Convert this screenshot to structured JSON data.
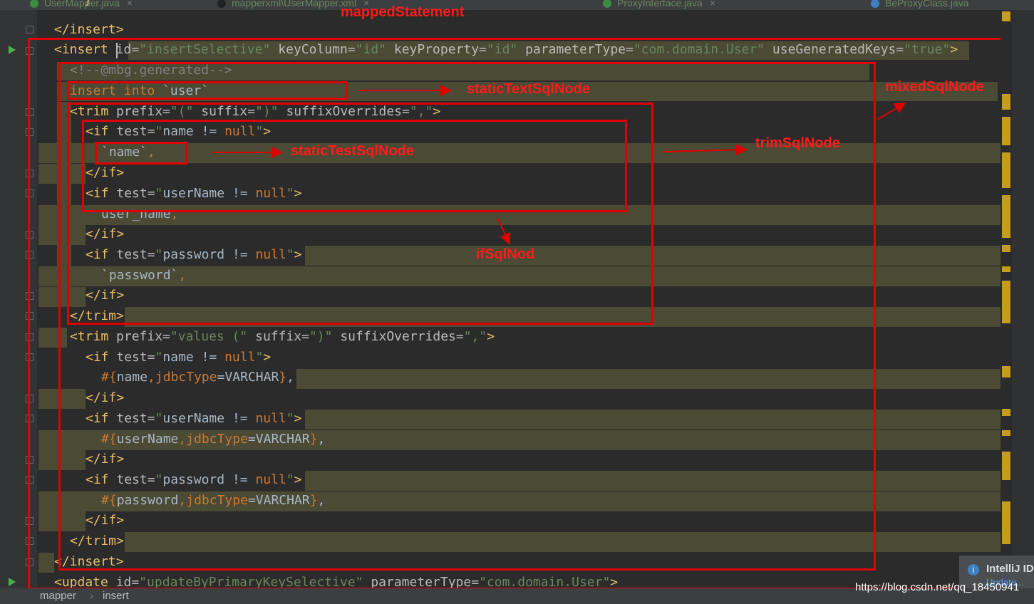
{
  "tabs": [
    {
      "label": "UserMapper.java",
      "close": "×"
    },
    {
      "label": "mapperxml\\UserMapper.xml",
      "close": "×"
    },
    {
      "label": "ProxyInterface.java",
      "close": "×"
    },
    {
      "label": "BeProxyClass.java",
      "close": "×"
    }
  ],
  "code": {
    "l0": "}",
    "l1_close_insert": "</insert>",
    "l2": {
      "open": "<insert ",
      "a1": "id=",
      "v1": "\"insertSelective\"",
      "a2": " keyColumn=",
      "v2": "\"id\"",
      "a3": " keyProperty=",
      "v3": "\"id\"",
      "a4": " parameterType=",
      "v4": "\"com.domain.User\"",
      "a5": " useGeneratedKeys=",
      "v5": "\"true\"",
      "close": ">"
    },
    "l3": "<!--@mbg.generated-->",
    "l4": {
      "kw": "insert into ",
      "txt": "`user`"
    },
    "l5": {
      "open": "<trim ",
      "a1": "prefix=",
      "v1": "\"(\"",
      "a2": " suffix=",
      "v2": "\")\"",
      "a3": " suffixOverrides=",
      "v3": "\",\"",
      "close": ">"
    },
    "l6": {
      "open": "<if ",
      "a1": "test=",
      "q1": "\"",
      "expr": "name != ",
      "nul": "null",
      "q2": "\"",
      "close": ">"
    },
    "l7": {
      "txt": "`name`",
      "comma": ","
    },
    "l8": "</if>",
    "l9": {
      "open": "<if ",
      "a1": "test=",
      "q1": "\"",
      "expr": "userName != ",
      "nul": "null",
      "q2": "\"",
      "close": ">"
    },
    "l10": {
      "txt": "user_name",
      "comma": ","
    },
    "l11": "</if>",
    "l12": {
      "open": "<if ",
      "a1": "test=",
      "q1": "\"",
      "expr": "password != ",
      "nul": "null",
      "q2": "\"",
      "close": ">"
    },
    "l13": {
      "txt": "`password`",
      "comma": ","
    },
    "l14": "</if>",
    "l15": "</trim>",
    "l16": {
      "open": "<trim ",
      "a1": "prefix=",
      "v1": "\"values (\"",
      "a2": " suffix=",
      "v2": "\")\"",
      "a3": " suffixOverrides=",
      "v3": "\",\"",
      "close": ">"
    },
    "l17": {
      "open": "<if ",
      "a1": "test=",
      "q1": "\"",
      "expr": "name != ",
      "nul": "null",
      "q2": "\"",
      "close": ">"
    },
    "l18": {
      "h": "#{",
      "p": "name",
      "c": ",",
      "j": "jdbcType",
      "e": "=",
      "t": "VARCHAR",
      "b": "}",
      "comma": ","
    },
    "l19": "</if>",
    "l20": {
      "open": "<if ",
      "a1": "test=",
      "q1": "\"",
      "expr": "userName != ",
      "nul": "null",
      "q2": "\"",
      "close": ">"
    },
    "l21": {
      "h": "#{",
      "p": "userName",
      "c": ",",
      "j": "jdbcType",
      "e": "=",
      "t": "VARCHAR",
      "b": "}",
      "comma": ","
    },
    "l22": "</if>",
    "l23": {
      "open": "<if ",
      "a1": "test=",
      "q1": "\"",
      "expr": "password != ",
      "nul": "null",
      "q2": "\"",
      "close": ">"
    },
    "l24": {
      "h": "#{",
      "p": "password",
      "c": ",",
      "j": "jdbcType",
      "e": "=",
      "t": "VARCHAR",
      "b": "}",
      "comma": ","
    },
    "l25": "</if>",
    "l26": "</trim>",
    "l27": "</insert>",
    "l28": {
      "open": "<update ",
      "a1": "id=",
      "v1": "\"updateByPrimaryKeySelective\"",
      "a2": " parameterType=",
      "v2": "\"com.domain.User\"",
      "close": ">"
    }
  },
  "annotations": {
    "mapped_statement": "mappedStatement",
    "static_text": "staticTextSqlNode",
    "mixed": "mixedSqlNode",
    "trim": "trimSqlNode",
    "static_test": "staticTestSqlNode",
    "if_node": "ifSqlNod"
  },
  "breadcrumb": {
    "root": "mapper",
    "sep": "›",
    "leaf": "insert"
  },
  "notification": {
    "title": "IntelliJ ID",
    "link": "Update..."
  },
  "watermark": "https://blog.csdn.net/qq_18450941",
  "colors": {
    "tag": "#e8bf6a",
    "string": "#6a8759",
    "keyword": "#cc7832",
    "annotation": "#ff1a1a"
  }
}
